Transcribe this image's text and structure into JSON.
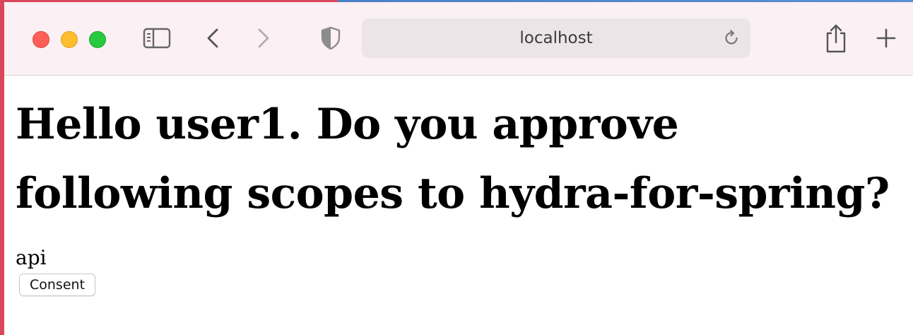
{
  "browser": {
    "address": "localhost",
    "colors": {
      "toolbar_bg": "#fbf0f3",
      "address_bg": "#ece5e8",
      "close": "#fe5f57",
      "minimize": "#febc2e",
      "zoom": "#28c840"
    },
    "icons": [
      "sidebar-icon",
      "back-icon",
      "forward-icon",
      "shield-icon",
      "reload-icon",
      "share-icon",
      "plus-icon"
    ]
  },
  "page": {
    "heading": "Hello user1. Do you approve following scopes to hydra-for-spring?",
    "scope": "api",
    "consent_label": "Consent"
  }
}
